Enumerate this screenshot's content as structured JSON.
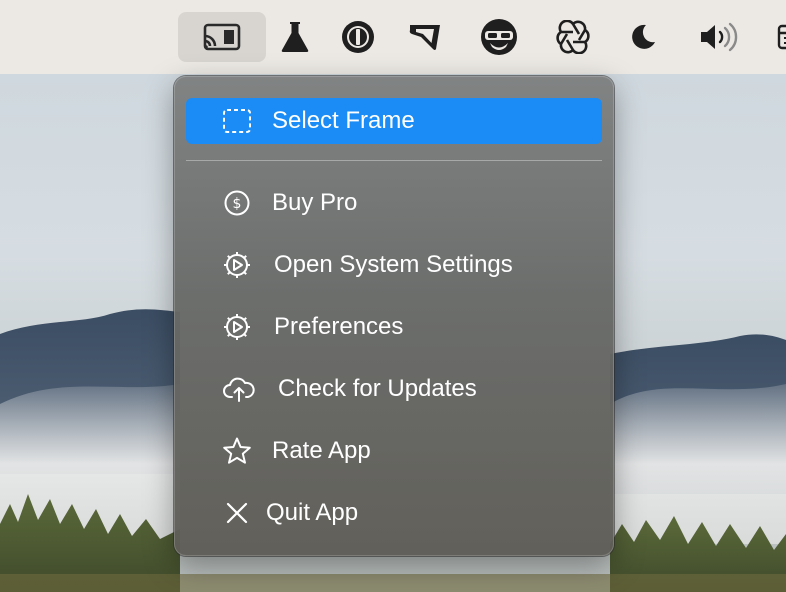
{
  "menubar": {
    "items": [
      {
        "icon": "screen-cast-icon",
        "active": true
      },
      {
        "icon": "flask-icon"
      },
      {
        "icon": "password-manager-icon"
      },
      {
        "icon": "cursor-tool-icon"
      },
      {
        "icon": "avatar-mask-icon"
      },
      {
        "icon": "openai-icon"
      },
      {
        "icon": "moon-icon"
      },
      {
        "icon": "volume-icon"
      },
      {
        "icon": "calendar-icon"
      }
    ]
  },
  "menu": {
    "items": [
      {
        "label": "Select Frame",
        "icon": "dashed-frame-icon",
        "highlighted": true
      },
      {
        "label": "Buy Pro",
        "icon": "dollar-circle-icon"
      },
      {
        "label": "Open System Settings",
        "icon": "gear-play-icon"
      },
      {
        "label": "Preferences",
        "icon": "gear-play-icon"
      },
      {
        "label": "Check for Updates",
        "icon": "cloud-upload-icon"
      },
      {
        "label": "Rate App",
        "icon": "star-icon"
      },
      {
        "label": "Quit App",
        "icon": "close-icon"
      }
    ]
  },
  "colors": {
    "highlight": "#1b8cf5",
    "menubar": "#ece9e4"
  }
}
